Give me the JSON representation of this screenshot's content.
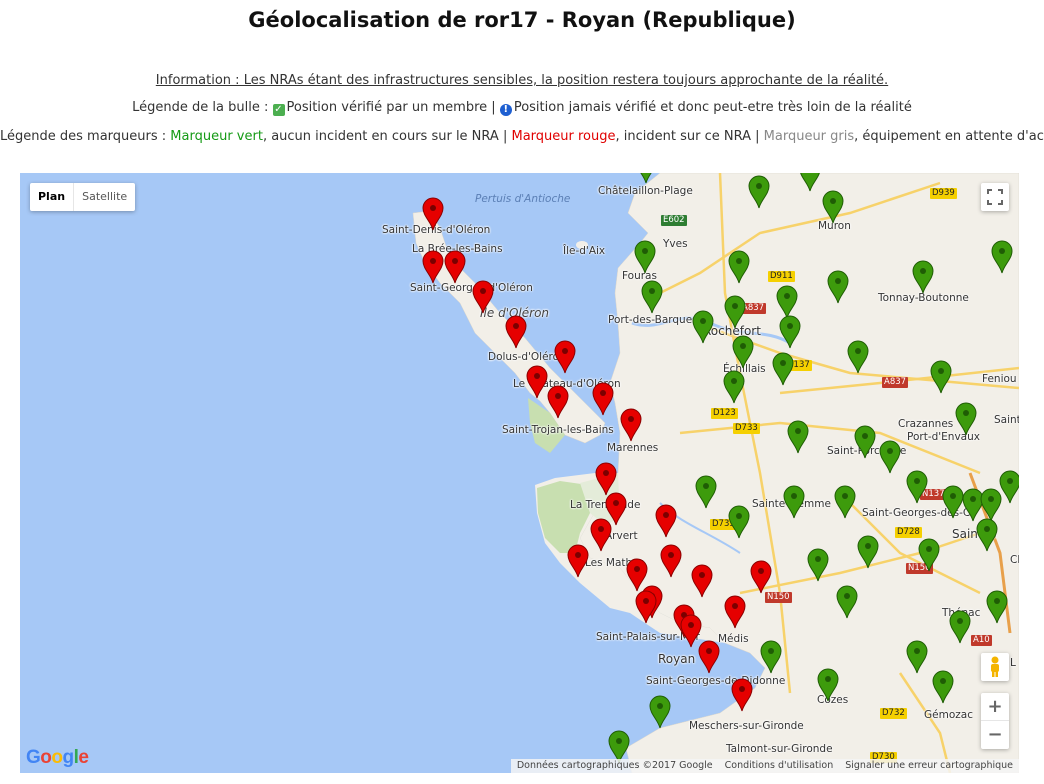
{
  "title": "Géolocalisation de ror17 - Royan (Republique)",
  "info": "Information : Les NRAs étant des infrastructures sensibles, la position restera toujours approchante de la réalité.",
  "bubble_legend": {
    "prefix": "Légende de la bulle :",
    "verified": "Position vérifié par un membre",
    "separator": "|",
    "unverified": "Position jamais vérifié et donc peut-etre très loin de la réalité"
  },
  "marker_legend": {
    "prefix": "Légende des marqueurs :",
    "green_label": "Marqueur vert",
    "green_text": ", aucun incident en cours sur le NRA",
    "separator": "|",
    "red_label": "Marqueur rouge",
    "red_text": ", incident sur ce NRA",
    "grey_label": "Marqueur gris",
    "grey_text": ", équipement en attente d'activation",
    "colors": {
      "green": "#159a15",
      "red": "#e00000",
      "grey": "#888888"
    }
  },
  "map": {
    "type_control": {
      "plan": "Plan",
      "satellite": "Satellite"
    },
    "zoom": {
      "in": "+",
      "out": "−"
    },
    "footer": {
      "data": "Données cartographiques ©2017 Google",
      "terms": "Conditions d'utilisation",
      "report": "Signaler une erreur cartographique"
    },
    "logo": "Google",
    "places": [
      "Pertuis d'Antioche",
      "Châtelaillon-Plage",
      "Saint-Denis-d'Oléron",
      "La Brée-les-Bains",
      "Île-d'Aix",
      "Yves",
      "Muron",
      "Saint-Georges-d'Oléron",
      "Fouras",
      "Tonnay-Boutonne",
      "Île d'Oléron",
      "Port-des-Barques",
      "Rochefort",
      "Dolus-d'Oléron",
      "Échillais",
      "Le Château-d'Oléron",
      "Feniou",
      "Crazannes",
      "Saint-Trojan-les-Bains",
      "Port-d'Envaux",
      "Marennes",
      "Saint-Porchaire",
      "Saint-H",
      "La Tremblade",
      "Sainte-Gemme",
      "Saint-Georges-des-C",
      "Arvert",
      "Saintes",
      "Les Mathes",
      "Thénac",
      "Saint-Palais-sur-Mer",
      "Médis",
      "Royan",
      "Saint-Georges-de-Didonne",
      "Cozes",
      "Gémozac",
      "Meschers-sur-Gironde",
      "Talmont-sur-Gironde",
      "Ch",
      "L"
    ],
    "roads": [
      "D939",
      "E602",
      "D911",
      "A837",
      "D137",
      "A837",
      "D123",
      "D733",
      "D733",
      "N137",
      "D728",
      "N150",
      "N150",
      "A10",
      "D732",
      "D730"
    ],
    "pin_colors": {
      "green": "#3d9b0c",
      "red": "#e60000"
    }
  }
}
